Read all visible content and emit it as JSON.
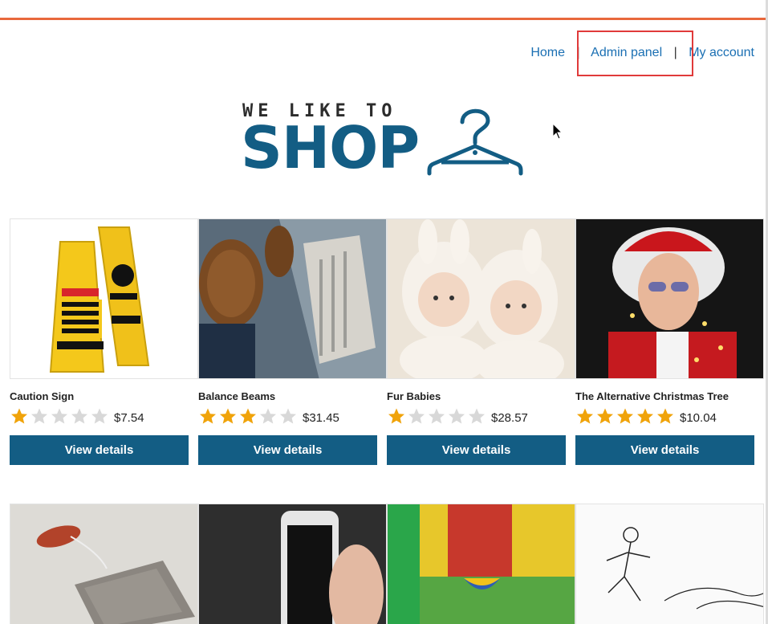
{
  "nav": {
    "items": [
      {
        "label": "Home"
      },
      {
        "label": "Admin panel"
      },
      {
        "label": "My account"
      }
    ],
    "separator": "|"
  },
  "logo": {
    "top_text": "WE LIKE TO",
    "main_text": "SHOP",
    "icon": "hanger-icon"
  },
  "products": [
    {
      "title": "Caution Sign",
      "rating": 1,
      "price": "$7.54",
      "button": "View details"
    },
    {
      "title": "Balance Beams",
      "rating": 3,
      "price": "$31.45",
      "button": "View details"
    },
    {
      "title": "Fur Babies",
      "rating": 1,
      "price": "$28.57",
      "button": "View details"
    },
    {
      "title": "The Alternative Christmas Tree",
      "rating": 5,
      "price": "$10.04",
      "button": "View details"
    }
  ],
  "colors": {
    "accent": "#e8683c",
    "brand": "#135d84",
    "link": "#1a6fb3",
    "star_on": "#f0a30a",
    "star_off": "#d8d8d8",
    "highlight": "#e03a3a"
  }
}
